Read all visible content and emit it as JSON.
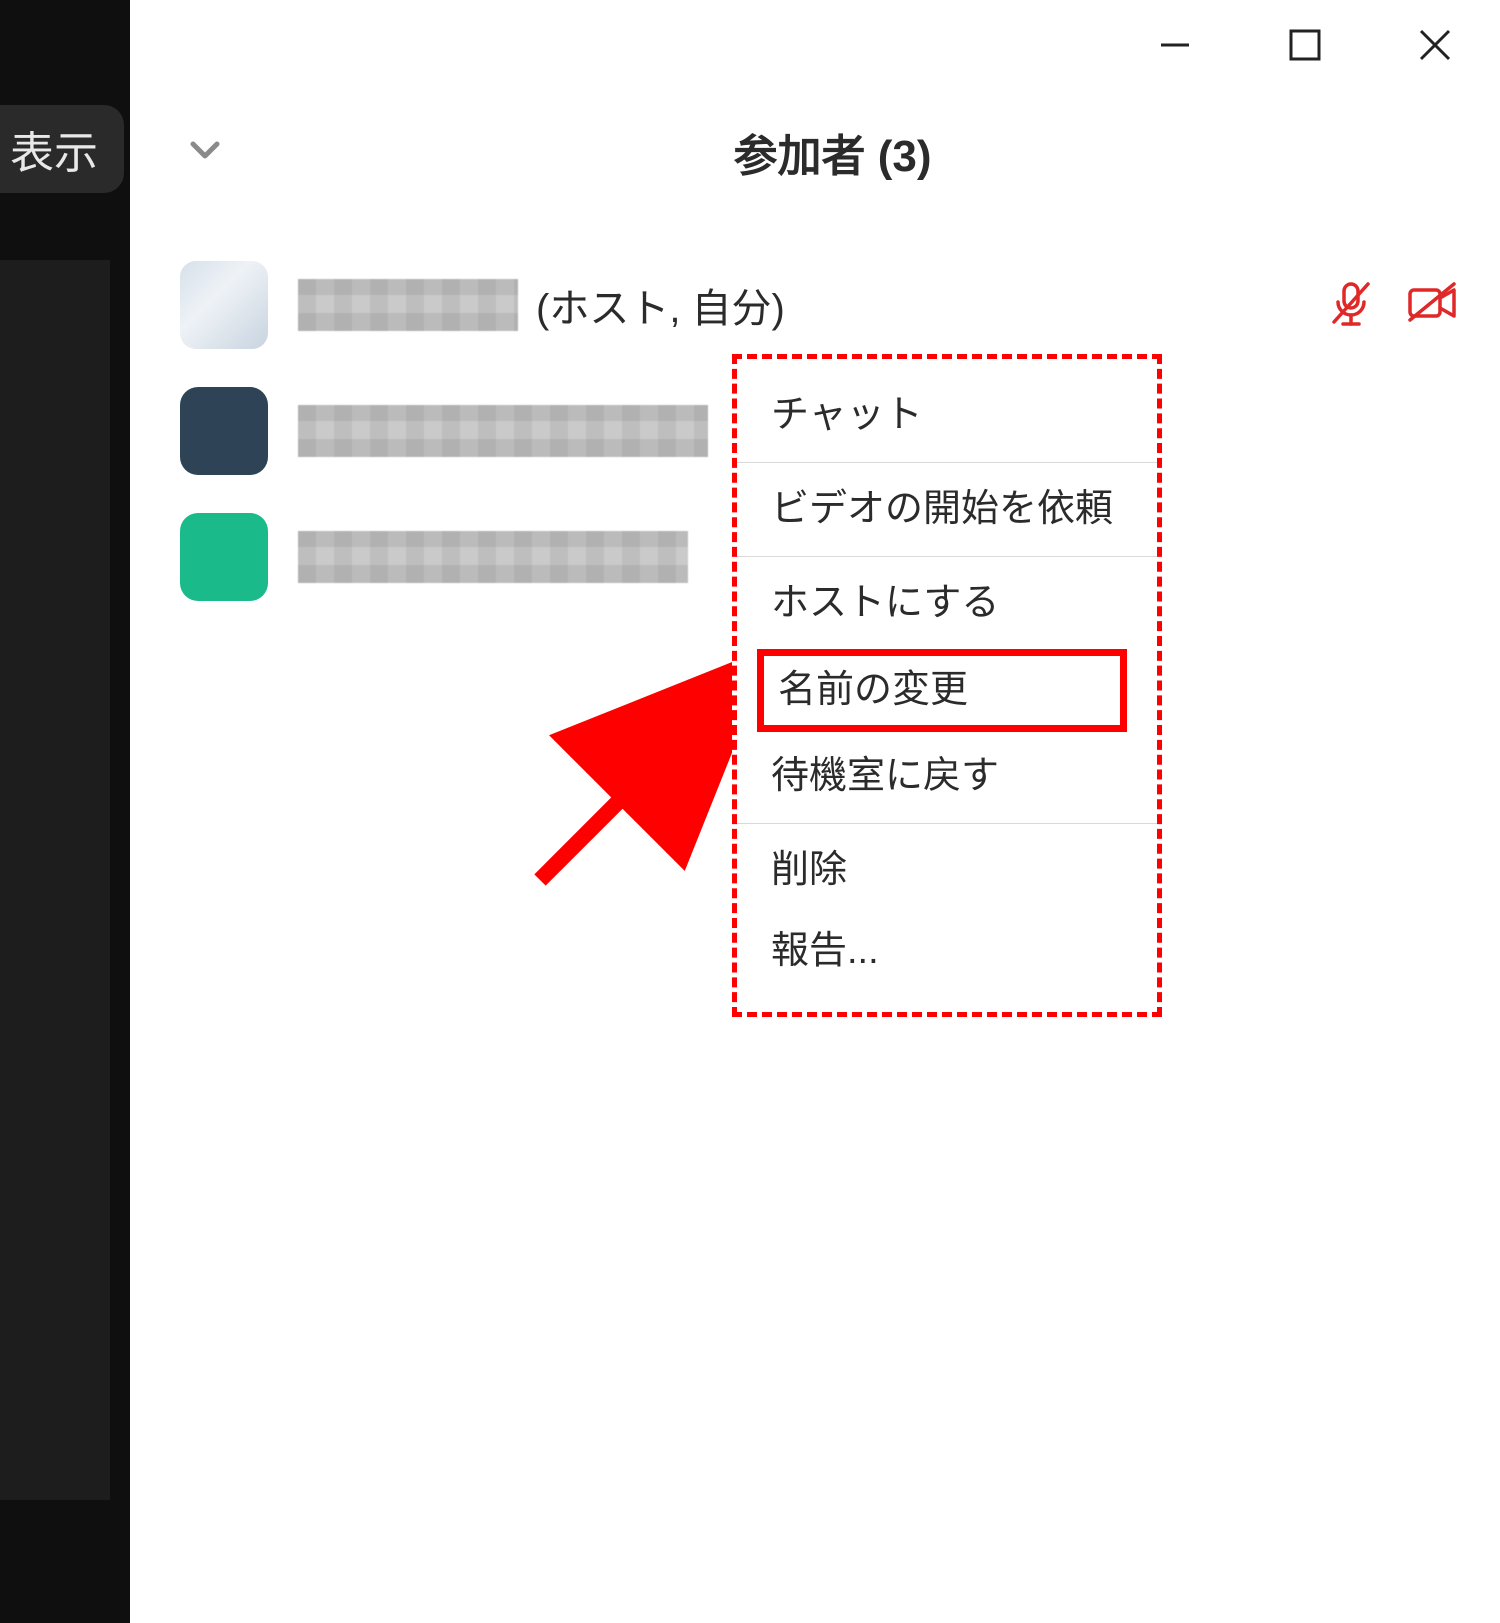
{
  "sidebar": {
    "view_label": "表示"
  },
  "window": {
    "minimize": "-",
    "maximize": "□",
    "close": "×"
  },
  "panel": {
    "title": "参加者 (3)"
  },
  "participants": [
    {
      "suffix": "(ホスト, 自分)",
      "muted": true,
      "video_off": true,
      "avatar": "light"
    },
    {
      "suffix": "",
      "avatar": "dark"
    },
    {
      "suffix": "",
      "avatar": "teal"
    }
  ],
  "context_menu": {
    "chat": "チャット",
    "ask_start_video": "ビデオの開始を依頼",
    "make_host": "ホストにする",
    "rename": "名前の変更",
    "waiting_room": "待機室に戻す",
    "remove": "削除",
    "report": "報告..."
  }
}
